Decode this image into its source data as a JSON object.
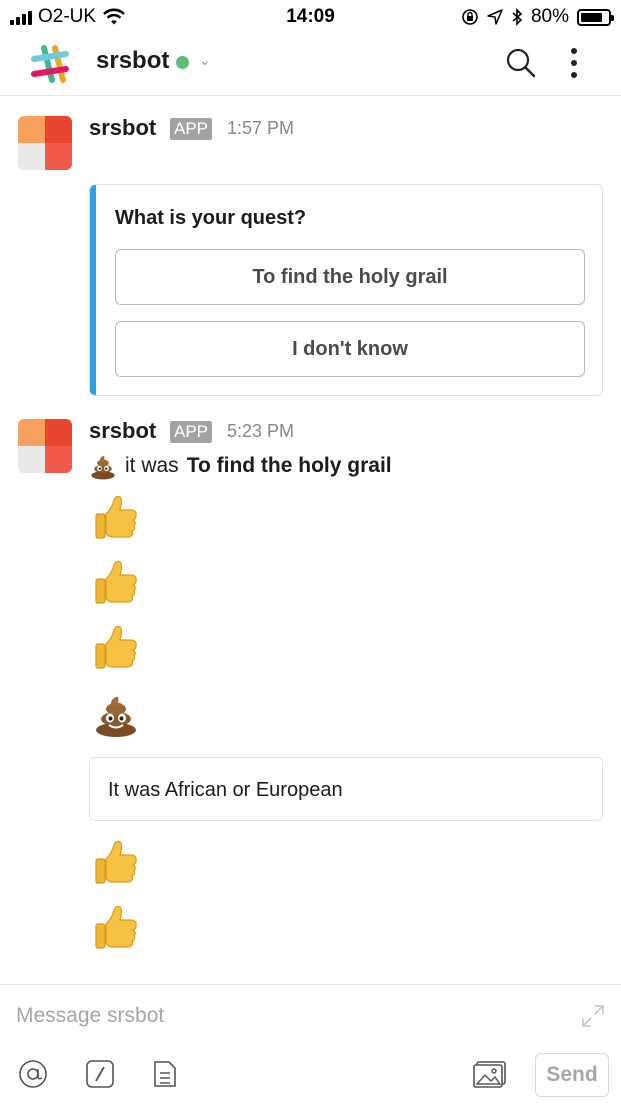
{
  "status_bar": {
    "carrier": "O2-UK",
    "time": "14:09",
    "battery": "80%",
    "battery_level": 0.8,
    "icons": [
      "signal-icon",
      "wifi-icon",
      "orientation-lock-icon",
      "location-icon",
      "bluetooth-icon",
      "battery-icon"
    ]
  },
  "header": {
    "title": "srsbot",
    "presence_color": "#5dbb7e",
    "icons": [
      "slack-logo-icon",
      "chevron-down-icon",
      "search-icon",
      "more-vertical-icon"
    ]
  },
  "messages": [
    {
      "author": "srsbot",
      "badge": "APP",
      "time": "1:57 PM",
      "attachment": {
        "question": "What is your quest?",
        "accent_color": "#2d9ee0",
        "buttons": [
          "To find the holy grail",
          "I don't know"
        ]
      }
    },
    {
      "author": "srsbot",
      "badge": "APP",
      "time": "5:23 PM",
      "text_prefix": "it was",
      "text_bold": "To find the holy grail",
      "emojis_before_quote": [
        "thumbs-up",
        "thumbs-up",
        "thumbs-up",
        "poop"
      ],
      "quote": "It was African or European",
      "emojis_after_quote": [
        "thumbs-up",
        "thumbs-up"
      ]
    }
  ],
  "composer": {
    "placeholder": "Message srsbot",
    "value": "",
    "send_label": "Send",
    "icons": [
      "at-sign-icon",
      "slash-command-icon",
      "snippet-icon",
      "image-icon",
      "expand-icon"
    ]
  },
  "colors": {
    "accent_blue": "#2d9ee0",
    "badge_gray": "#a3a3a3",
    "avatar_colors": [
      "#f8a15e",
      "#e8442e",
      "#e9e9e9",
      "#ef5a4b"
    ]
  }
}
